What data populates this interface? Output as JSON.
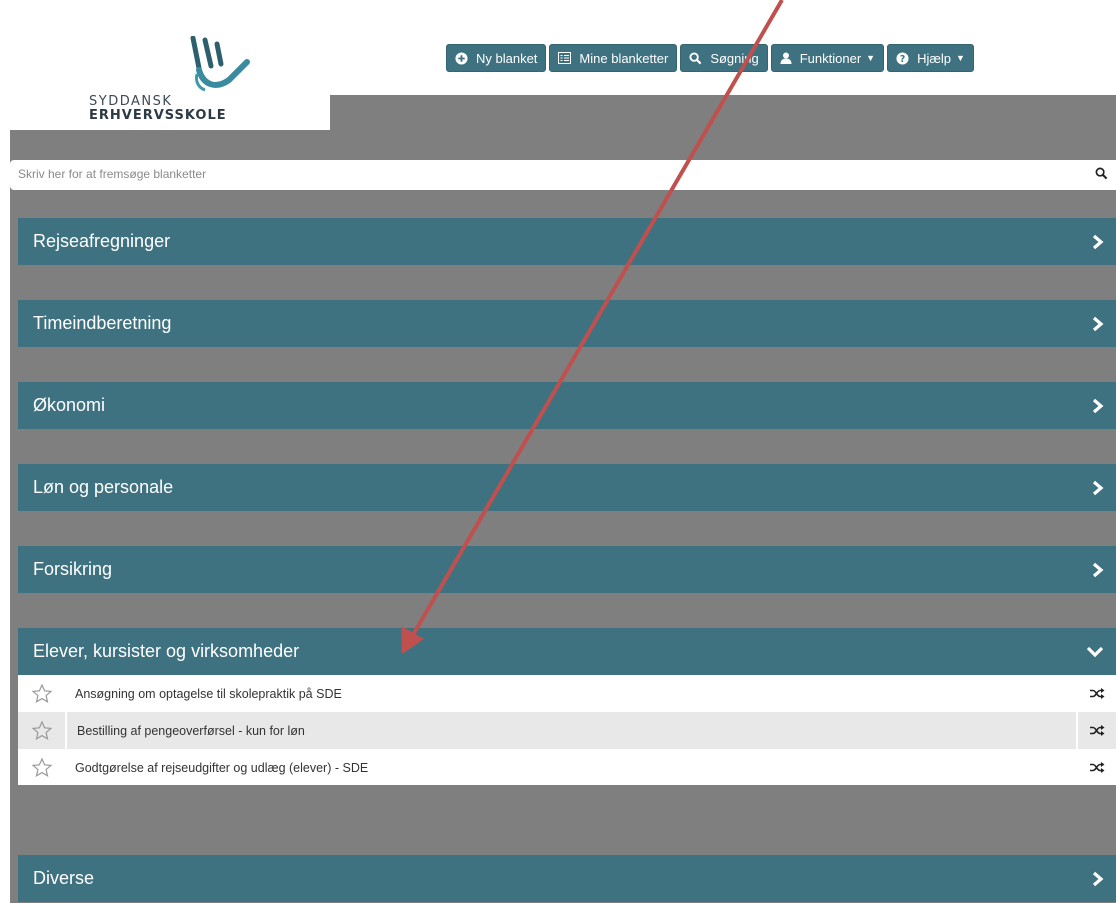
{
  "logo": {
    "line1": "SYDDANSK",
    "line2": "ERHVERVSSKOLE"
  },
  "nav": {
    "new_form": "Ny blanket",
    "my_forms": "Mine blanketter",
    "search": "Søgning",
    "functions": "Funktioner",
    "help": "Hjælp"
  },
  "search": {
    "placeholder": "Skriv her for at fremsøge blanketter"
  },
  "categories": [
    {
      "label": "Rejseafregninger"
    },
    {
      "label": "Timeindberetning"
    },
    {
      "label": "Økonomi"
    },
    {
      "label": "Løn og personale"
    },
    {
      "label": "Forsikring"
    },
    {
      "label": "Elever, kursister og virksomheder",
      "expanded": true
    },
    {
      "label": "Diverse"
    }
  ],
  "forms": [
    {
      "label": "Ansøgning om optagelse til skolepraktik på SDE"
    },
    {
      "label": "Bestilling af pengeoverførsel - kun for løn"
    },
    {
      "label": "Godtgørelse af rejseudgifter og udlæg (elever) - SDE"
    }
  ],
  "colors": {
    "accent": "#3f7280",
    "background": "#7f7f7f",
    "annotation_arrow": "#c0504d"
  }
}
